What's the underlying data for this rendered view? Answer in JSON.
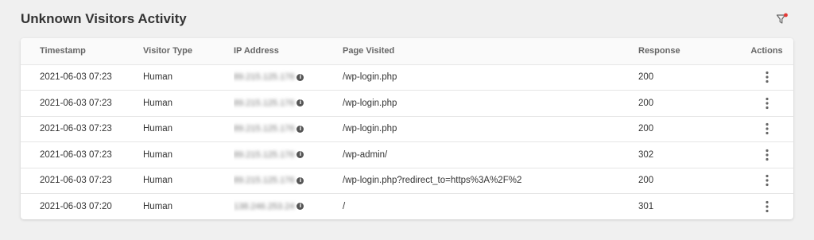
{
  "page": {
    "title": "Unknown Visitors Activity",
    "icons": {
      "filter": "filter-icon",
      "filter_badge_color": "#e53935"
    }
  },
  "table": {
    "columns": {
      "timestamp": "Timestamp",
      "visitor_type": "Visitor Type",
      "ip_address": "IP Address",
      "page_visited": "Page Visited",
      "response": "Response",
      "actions": "Actions"
    },
    "rows": [
      {
        "timestamp": "2021-06-03 07:23",
        "visitor_type": "Human",
        "ip": "89.215.125.176",
        "page": "/wp-login.php",
        "response": "200"
      },
      {
        "timestamp": "2021-06-03 07:23",
        "visitor_type": "Human",
        "ip": "89.215.125.176",
        "page": "/wp-login.php",
        "response": "200"
      },
      {
        "timestamp": "2021-06-03 07:23",
        "visitor_type": "Human",
        "ip": "89.215.125.176",
        "page": "/wp-login.php",
        "response": "200"
      },
      {
        "timestamp": "2021-06-03 07:23",
        "visitor_type": "Human",
        "ip": "89.215.125.176",
        "page": "/wp-admin/",
        "response": "302"
      },
      {
        "timestamp": "2021-06-03 07:23",
        "visitor_type": "Human",
        "ip": "89.215.125.176",
        "page": "/wp-login.php?redirect_to=https%3A%2F%2",
        "response": "200"
      },
      {
        "timestamp": "2021-06-03 07:20",
        "visitor_type": "Human",
        "ip": "138.246.253.24",
        "page": "/",
        "response": "301"
      }
    ]
  }
}
